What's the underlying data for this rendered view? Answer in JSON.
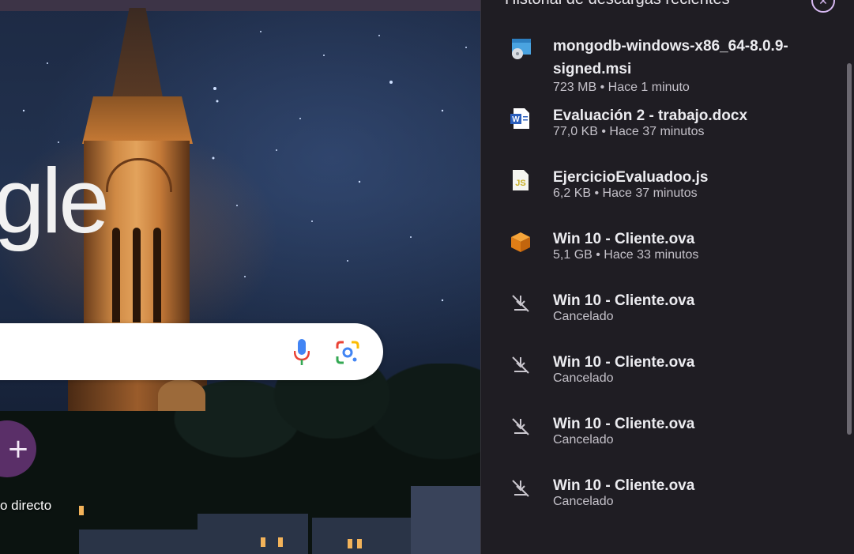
{
  "newtab": {
    "logo_fragment": "gle",
    "shortcut": {
      "icon": "plus-icon",
      "label": "o directo"
    }
  },
  "downloads": {
    "title": "Historial de descargas recientes",
    "close_icon": "close-icon",
    "items": [
      {
        "name": "mongodb-windows-x86_64-8.0.9-signed.msi",
        "meta": "723 MB • Hace 1 minuto",
        "icon": "installer-icon"
      },
      {
        "name": "Evaluación 2 - trabajo.docx",
        "meta": "77,0 KB • Hace 37 minutos",
        "icon": "word-document-icon"
      },
      {
        "name": "EjercicioEvaluadoo.js",
        "meta": "6,2 KB • Hace 37 minutos",
        "icon": "javascript-file-icon"
      },
      {
        "name": "Win 10 - Cliente.ova",
        "meta": "5,1 GB • Hace 33 minutos",
        "icon": "virtualbox-appliance-icon"
      },
      {
        "name": "Win 10 - Cliente.ova",
        "meta": "Cancelado",
        "icon": "download-cancelled-icon"
      },
      {
        "name": "Win 10 - Cliente.ova",
        "meta": "Cancelado",
        "icon": "download-cancelled-icon"
      },
      {
        "name": "Win 10 - Cliente.ova",
        "meta": "Cancelado",
        "icon": "download-cancelled-icon"
      },
      {
        "name": "Win 10 - Cliente.ova",
        "meta": "Cancelado",
        "icon": "download-cancelled-icon"
      }
    ]
  },
  "colors": {
    "panel_bg": "#1f1d23",
    "accent": "#d7b9f2",
    "shortcut_bg": "#5a2f68"
  }
}
